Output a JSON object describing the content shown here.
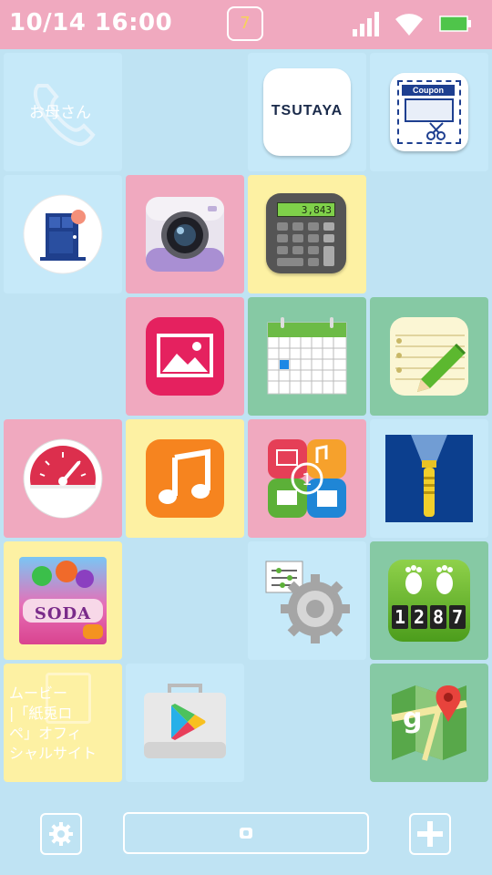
{
  "status_bar": {
    "time": "10/14 16:00",
    "notification_count": "7",
    "signal_icon": "signal-icon",
    "wifi_icon": "wifi-icon",
    "battery_icon": "battery-icon"
  },
  "tiles": {
    "mother": {
      "label": "お母さん",
      "icon": "phone-icon"
    },
    "tsutaya": {
      "label": "TSUTAYA"
    },
    "coupon": {
      "label": "Coupon",
      "icon": "coupon-icon"
    },
    "door": {
      "icon": "door-icon"
    },
    "camera": {
      "icon": "camera-icon"
    },
    "calculator": {
      "display": "3,843",
      "icon": "calculator-icon"
    },
    "gallery": {
      "icon": "gallery-icon"
    },
    "calendar": {
      "icon": "calendar-icon"
    },
    "memo": {
      "icon": "memo-icon"
    },
    "speedometer": {
      "icon": "speedometer-icon"
    },
    "music": {
      "icon": "music-icon"
    },
    "file_manager": {
      "icon": "file-manager-icon"
    },
    "flashlight": {
      "icon": "flashlight-icon"
    },
    "candy_crush": {
      "label": "SODA",
      "icon": "candy-crush-soda-icon"
    },
    "settings": {
      "icon": "settings-icon"
    },
    "pedometer": {
      "digits": [
        "1",
        "2",
        "8",
        "7"
      ],
      "icon": "pedometer-icon"
    },
    "movie_site": {
      "label": "ムービー\n|「紙兎ロ\nペ」オフィ\nシャルサイト"
    },
    "play_store": {
      "icon": "play-store-icon"
    },
    "maps": {
      "icon": "maps-icon"
    }
  },
  "colors": {
    "background": "#bfe3f3",
    "status_bar": "#f0a9bf",
    "tile_blue": "#c6e9f9",
    "tile_pink": "#f0a9bf",
    "tile_yellow": "#fdf1a3",
    "tile_green": "#86c9a4"
  },
  "bottom_bar": {
    "settings_icon": "gear-icon",
    "home_icon": "home-icon",
    "add_icon": "plus-icon"
  }
}
